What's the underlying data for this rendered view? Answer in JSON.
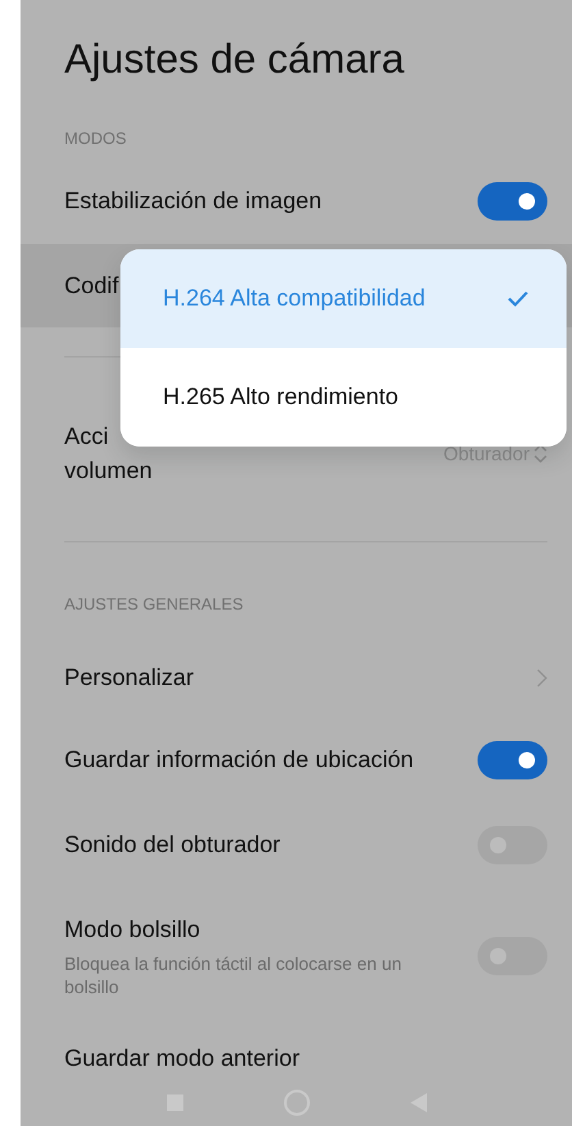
{
  "title": "Ajustes de cámara",
  "sections": [
    {
      "header": "MODOS",
      "items": [
        {
          "kind": "switch",
          "label": "Estabilización de imagen",
          "on": true
        },
        {
          "kind": "option",
          "label": "Codif",
          "pressed": true
        },
        {
          "kind": "value",
          "label_lines": [
            "Acci",
            "volumen"
          ],
          "value": "Obturador"
        }
      ]
    },
    {
      "header": "AJUSTES GENERALES",
      "items": [
        {
          "kind": "link",
          "label": "Personalizar"
        },
        {
          "kind": "switch",
          "label": "Guardar información de ubicación",
          "on": true
        },
        {
          "kind": "switch",
          "label": "Sonido del obturador",
          "on": false
        },
        {
          "kind": "switch",
          "label": "Modo bolsillo",
          "description": "Bloquea la función táctil al colocarse en un bolsillo",
          "on": false
        },
        {
          "kind": "text",
          "label": "Guardar modo anterior"
        }
      ]
    }
  ],
  "popup": {
    "options": [
      {
        "label": "H.264 Alta compatibilidad",
        "selected": true
      },
      {
        "label": "H.265 Alto rendimiento",
        "selected": false
      }
    ]
  }
}
